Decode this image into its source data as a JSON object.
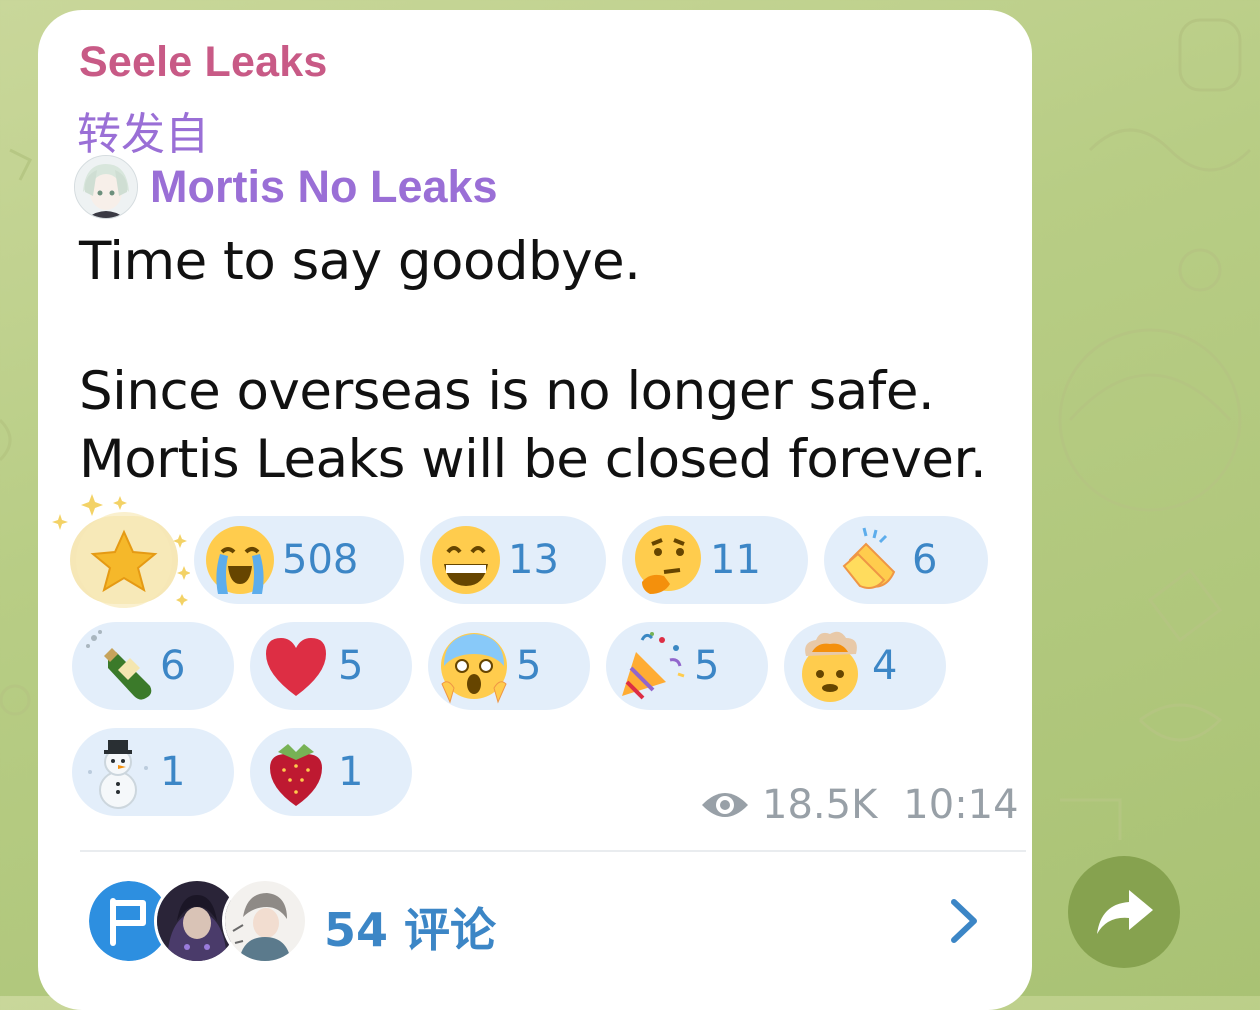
{
  "header": {
    "channel_name": "Seele Leaks",
    "forwarded_label": "转发自",
    "forwarded_from": "Mortis No Leaks"
  },
  "message": {
    "lines": [
      "Time to say goodbye.",
      "",
      "Since overseas is no longer safe.",
      "Mortis Leaks will be closed forever."
    ]
  },
  "reactions": [
    {
      "emoji": "star-icon",
      "count": ""
    },
    {
      "emoji": "crying-face-icon",
      "count": "508"
    },
    {
      "emoji": "grinning-face-icon",
      "count": "13"
    },
    {
      "emoji": "thinking-face-icon",
      "count": "11"
    },
    {
      "emoji": "clapping-hands-icon",
      "count": "6"
    },
    {
      "emoji": "champagne-icon",
      "count": "6"
    },
    {
      "emoji": "heart-icon",
      "count": "5"
    },
    {
      "emoji": "screaming-face-icon",
      "count": "5"
    },
    {
      "emoji": "party-popper-icon",
      "count": "5"
    },
    {
      "emoji": "exploding-head-icon",
      "count": "4"
    },
    {
      "emoji": "snowman-icon",
      "count": "1"
    },
    {
      "emoji": "strawberry-icon",
      "count": "1"
    }
  ],
  "meta": {
    "views": "18.5K",
    "time": "10:14"
  },
  "comments": {
    "label": "54 评论"
  },
  "colors": {
    "channel_name": "#c85a86",
    "forward": "#9a6fd6",
    "accent": "#3c86c6",
    "reaction_bg": "#e3eefa",
    "share_button": "#86a24f"
  }
}
